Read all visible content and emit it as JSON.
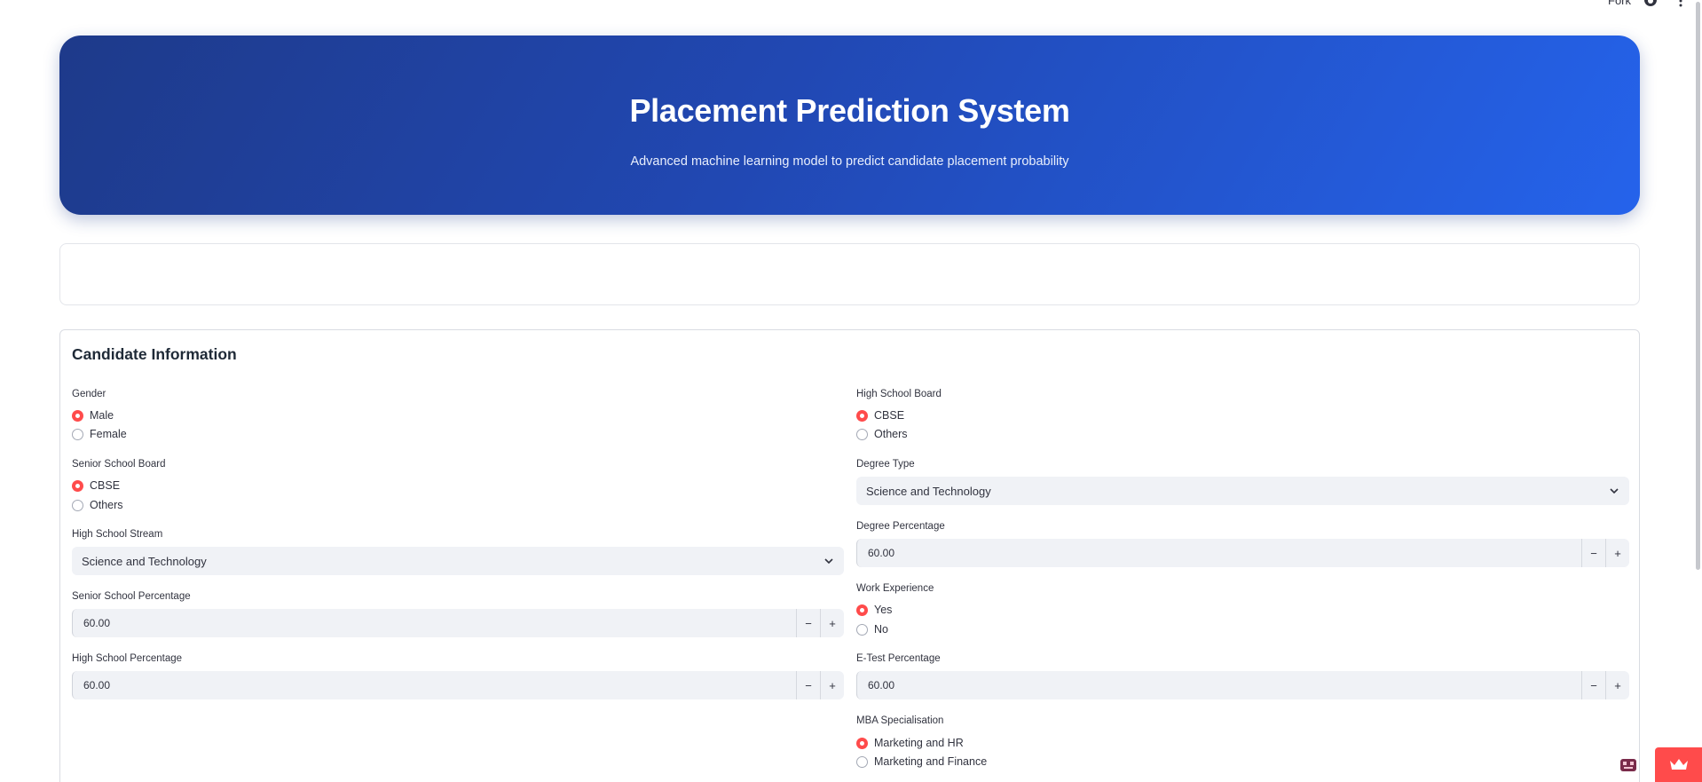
{
  "topbar": {
    "fork_label": "Fork"
  },
  "hero": {
    "title": "Placement Prediction System",
    "subtitle": "Advanced machine learning model to predict candidate placement probability"
  },
  "form": {
    "title": "Candidate Information",
    "left": {
      "gender": {
        "label": "Gender",
        "options": [
          "Male",
          "Female"
        ],
        "selected": "Male"
      },
      "senior_school_board": {
        "label": "Senior School Board",
        "options": [
          "CBSE",
          "Others"
        ],
        "selected": "CBSE"
      },
      "high_school_stream": {
        "label": "High School Stream",
        "value": "Science and Technology"
      },
      "senior_school_percentage": {
        "label": "Senior School Percentage",
        "value": "60.00"
      },
      "high_school_percentage": {
        "label": "High School Percentage",
        "value": "60.00"
      }
    },
    "right": {
      "high_school_board": {
        "label": "High School Board",
        "options": [
          "CBSE",
          "Others"
        ],
        "selected": "CBSE"
      },
      "degree_type": {
        "label": "Degree Type",
        "value": "Science and Technology"
      },
      "degree_percentage": {
        "label": "Degree Percentage",
        "value": "60.00"
      },
      "work_experience": {
        "label": "Work Experience",
        "options": [
          "Yes",
          "No"
        ],
        "selected": "Yes"
      },
      "etest_percentage": {
        "label": "E-Test Percentage",
        "value": "60.00"
      },
      "mba_specialisation": {
        "label": "MBA Specialisation",
        "options": [
          "Marketing and HR",
          "Marketing and Finance"
        ],
        "selected": "Marketing and HR"
      }
    },
    "stepper": {
      "minus": "−",
      "plus": "+"
    }
  },
  "icons": {
    "github": "github-icon",
    "kebab": "kebab-menu-icon",
    "chevron": "chevron-down-icon",
    "crown": "crown-icon",
    "avatar": "pixel-avatar-icon"
  },
  "colors": {
    "accent": "#ff4b4b",
    "hero_start": "#1e3a8a",
    "hero_end": "#2563eb",
    "input_bg": "#f0f2f6"
  }
}
